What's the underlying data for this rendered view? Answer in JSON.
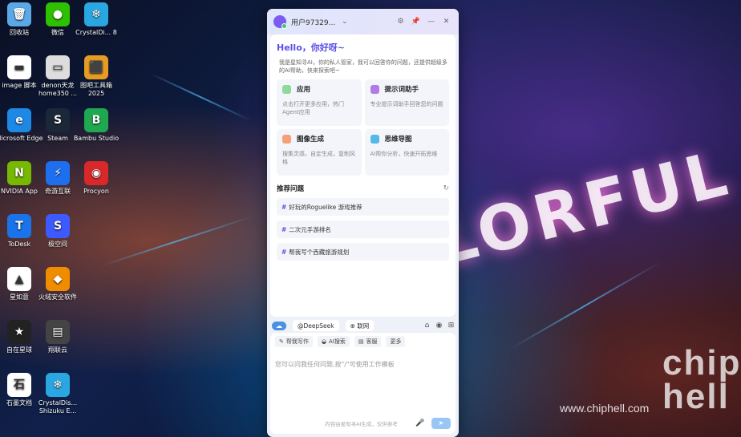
{
  "desktop": {
    "icons": [
      {
        "label": "回收站",
        "color": "#5aa9e6",
        "glyph": "🗑"
      },
      {
        "label": "微信",
        "color": "#2dc100",
        "glyph": "●"
      },
      {
        "label": "CrystalDi... 8",
        "color": "#2aa7e0",
        "glyph": "❄"
      },
      {
        "label": "image 脚本",
        "color": "#ffffff",
        "glyph": "▬"
      },
      {
        "label": "denon天龙 home350 ...",
        "color": "#dddddd",
        "glyph": "▭"
      },
      {
        "label": "图吧工具箱 2025",
        "color": "#e69c24",
        "glyph": "⬛"
      },
      {
        "label": "Microsoft Edge",
        "color": "#1e88e5",
        "glyph": "e"
      },
      {
        "label": "Steam",
        "color": "#1b2838",
        "glyph": "S"
      },
      {
        "label": "Bambu Studio",
        "color": "#1fa84f",
        "glyph": "B"
      },
      {
        "label": "NVIDIA App",
        "color": "#76b900",
        "glyph": "N"
      },
      {
        "label": "奇游互联",
        "color": "#1e6ff0",
        "glyph": "⚡"
      },
      {
        "label": "Procyon",
        "color": "#d8282a",
        "glyph": "◉"
      },
      {
        "label": "ToDesk",
        "color": "#1a73e8",
        "glyph": "T"
      },
      {
        "label": "极空间",
        "color": "#3d5afe",
        "glyph": "S"
      },
      {
        "label": "星如意",
        "color": "#ffffff",
        "glyph": "▲"
      },
      {
        "label": "火绒安全软件",
        "color": "#f08c00",
        "glyph": "◆"
      },
      {
        "label": "自在星球",
        "color": "#222222",
        "glyph": "★"
      },
      {
        "label": "翔联云",
        "color": "#444444",
        "glyph": "▤"
      },
      {
        "label": "石墨文档",
        "color": "#ffffff",
        "glyph": "石"
      },
      {
        "label": "CrystalDis... Shizuku E...",
        "color": "#2aa7e0",
        "glyph": "❄"
      }
    ],
    "wallpaper_text": "LORFUL",
    "watermark": "www.chiphell.com",
    "logo": "chip hell"
  },
  "window": {
    "username": "用户97329...",
    "greeting": "Hello，你好呀~",
    "intro": "我是星知寻AI，你的私人管家，我可以回答你的问题，还提供超级多的AI帮助，快来探索吧~",
    "cards": [
      {
        "title": "应用",
        "desc": "点击打开更多应用，热门Agent应用",
        "color": "#8fd99a"
      },
      {
        "title": "提示词助手",
        "desc": "专业提示词助手回答您的问题",
        "color": "#b07ae8"
      },
      {
        "title": "图像生成",
        "desc": "搜集灵感，自定生成，复制风格",
        "color": "#f5a07a"
      },
      {
        "title": "思维导图",
        "desc": "AI帮你分析，快速开拓思维",
        "color": "#56b8e6"
      }
    ],
    "recommend_title": "推荐问题",
    "questions": [
      "好玩的Roguelike 游戏推荐",
      "二次元手游排名",
      "帮我写个西藏旅游规划"
    ],
    "model_chip": "@DeepSeek",
    "web_chip": "联网",
    "quick_tools": [
      {
        "icon": "✎",
        "label": "帮我写作"
      },
      {
        "icon": "◒",
        "label": "AI搜索"
      },
      {
        "icon": "▤",
        "label": "客服"
      },
      {
        "icon": "",
        "label": "更多"
      }
    ],
    "input_placeholder": "您可以问我任何问题,按\"/\"可使用工作模板",
    "disclaimer": "内容由星知寻AI生成，仅供参考"
  }
}
